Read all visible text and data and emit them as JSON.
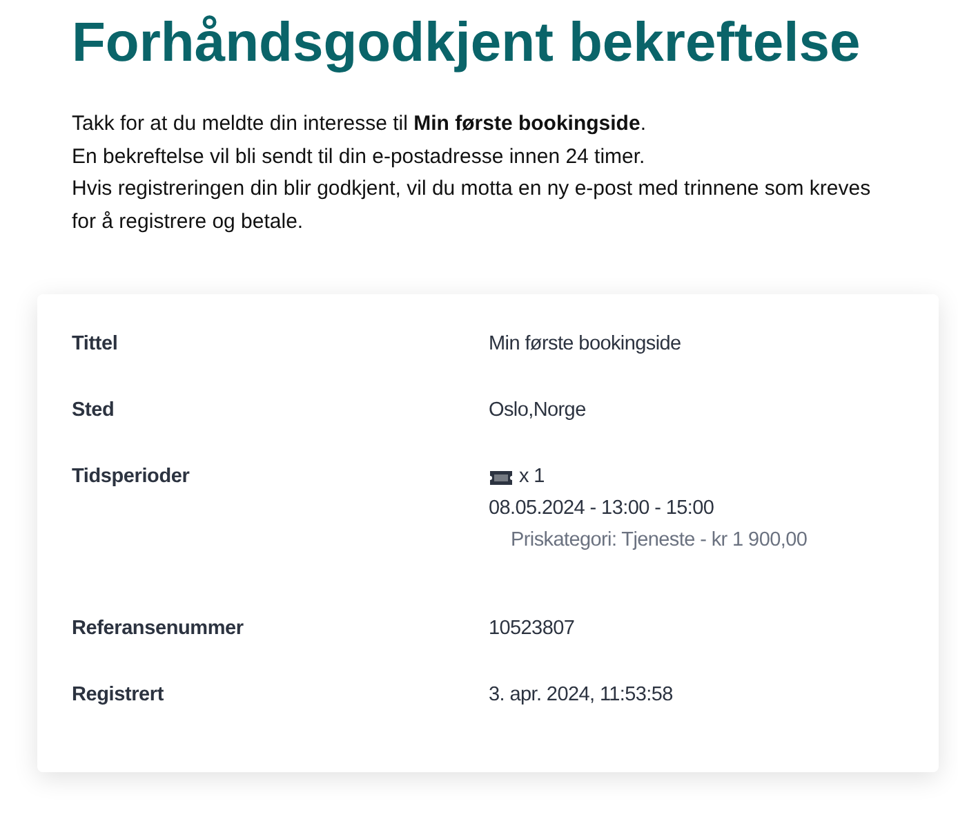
{
  "title": "Forhåndsgodkjent bekreftelse",
  "intro": [
    "Takk for at du meldte din interesse til **Min første bookingside**.",
    "En bekreftelse vil bli sendt til din e-postadresse innen 24 timer.",
    "Hvis registreringen din blir godkjent, vil du motta en ny e-post med trinnene som kreves for å registrere og betale."
  ],
  "details": [
    {
      "kind": "text",
      "label": "Tittel",
      "value": "Min første bookingside"
    },
    {
      "kind": "text",
      "label": "Sted",
      "value": "Oslo,Norge"
    },
    {
      "kind": "timeslots",
      "label": "Tidsperioder",
      "quantity": "x 1",
      "period": "08.05.2024 - 13:00 - 15:00",
      "price": "Priskategori: Tjeneste - kr 1 900,00"
    },
    {
      "kind": "text",
      "label": "Referansenummer",
      "value": "10523807"
    },
    {
      "kind": "text",
      "label": "Registrert",
      "value": "3. apr. 2024, 11:53:58"
    }
  ]
}
